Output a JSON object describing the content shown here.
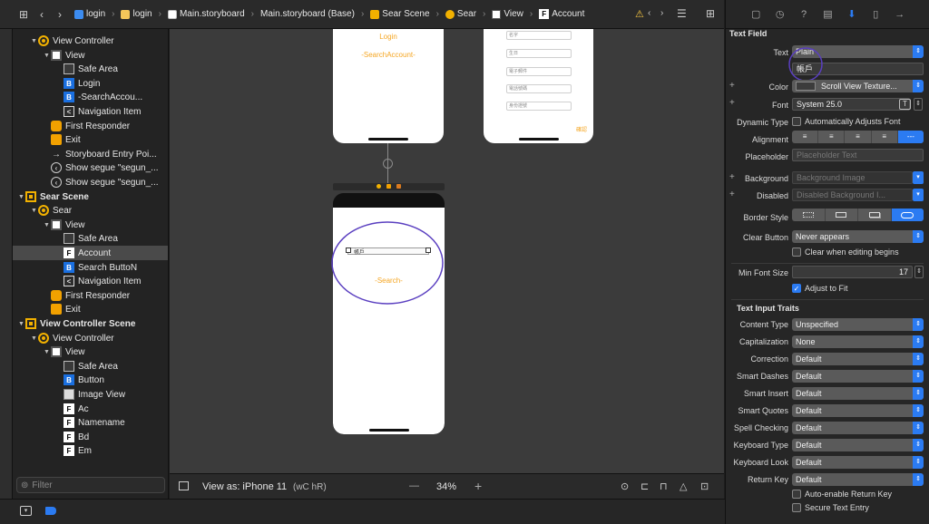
{
  "breadcrumb": [
    "login",
    "login",
    "Main.storyboard",
    "Main.storyboard (Base)",
    "Sear Scene",
    "Sear",
    "View",
    "Account"
  ],
  "navigator": {
    "rows": [
      {
        "label": "View Controller",
        "indent": 1,
        "tri": "▼",
        "icon": "vc"
      },
      {
        "label": "View",
        "indent": 2,
        "tri": "▼",
        "icon": "view"
      },
      {
        "label": "Safe Area",
        "indent": 3,
        "tri": "",
        "icon": "safe"
      },
      {
        "label": "Login",
        "indent": 3,
        "tri": "",
        "icon": "btn",
        "glyph": "B"
      },
      {
        "label": "-SearchAccou...",
        "indent": 3,
        "tri": "",
        "icon": "btn",
        "glyph": "B"
      },
      {
        "label": "Navigation Item",
        "indent": 3,
        "tri": "",
        "icon": "nav",
        "glyph": "<"
      },
      {
        "label": "First Responder",
        "indent": 2,
        "tri": "",
        "icon": "fr"
      },
      {
        "label": "Exit",
        "indent": 2,
        "tri": "",
        "icon": "exit"
      },
      {
        "label": "Storyboard Entry Poi...",
        "indent": 2,
        "tri": "",
        "icon": "arrow",
        "glyph": "→"
      },
      {
        "label": "Show segue \"segun_...",
        "indent": 2,
        "tri": "",
        "icon": "segue",
        "glyph": "‹"
      },
      {
        "label": "Show segue \"segun_...",
        "indent": 2,
        "tri": "",
        "icon": "segue",
        "glyph": "‹"
      },
      {
        "label": "Sear Scene",
        "indent": 0,
        "tri": "▼",
        "icon": "scn",
        "scene": true
      },
      {
        "label": "Sear",
        "indent": 1,
        "tri": "▼",
        "icon": "vc"
      },
      {
        "label": "View",
        "indent": 2,
        "tri": "▼",
        "icon": "view"
      },
      {
        "label": "Safe Area",
        "indent": 3,
        "tri": "",
        "icon": "safe"
      },
      {
        "label": "Account",
        "indent": 3,
        "tri": "",
        "icon": "f",
        "glyph": "F",
        "selected": true
      },
      {
        "label": "Search ButtoN",
        "indent": 3,
        "tri": "",
        "icon": "btn",
        "glyph": "B"
      },
      {
        "label": "Navigation Item",
        "indent": 3,
        "tri": "",
        "icon": "nav",
        "glyph": "<"
      },
      {
        "label": "First Responder",
        "indent": 2,
        "tri": "",
        "icon": "fr"
      },
      {
        "label": "Exit",
        "indent": 2,
        "tri": "",
        "icon": "exit"
      },
      {
        "label": "View Controller Scene",
        "indent": 0,
        "tri": "▼",
        "icon": "scn",
        "scene": true
      },
      {
        "label": "View Controller",
        "indent": 1,
        "tri": "▼",
        "icon": "vc"
      },
      {
        "label": "View",
        "indent": 2,
        "tri": "▼",
        "icon": "view"
      },
      {
        "label": "Safe Area",
        "indent": 3,
        "tri": "",
        "icon": "safe"
      },
      {
        "label": "Button",
        "indent": 3,
        "tri": "",
        "icon": "btn",
        "glyph": "B"
      },
      {
        "label": "Image View",
        "indent": 3,
        "tri": "",
        "icon": "img"
      },
      {
        "label": "Ac",
        "indent": 3,
        "tri": "",
        "icon": "f",
        "glyph": "F"
      },
      {
        "label": "Namename",
        "indent": 3,
        "tri": "",
        "icon": "f",
        "glyph": "F"
      },
      {
        "label": "Bd",
        "indent": 3,
        "tri": "",
        "icon": "f",
        "glyph": "F"
      },
      {
        "label": "Em",
        "indent": 3,
        "tri": "",
        "icon": "f",
        "glyph": "F"
      }
    ],
    "filter_placeholder": "Filter"
  },
  "canvas": {
    "login_label": "Login",
    "search_account_label": "-SearchAccount-",
    "register_fields": [
      "名字",
      "生日",
      "電子郵件",
      "電話號碼",
      "身份證號"
    ],
    "register_button": "確認",
    "account_placeholder": "帳戶",
    "search_label": "-Search-",
    "view_as": "View as: iPhone 11",
    "size_class": "(wC hR)",
    "zoom": "34%",
    "zoom_minus": "—",
    "zoom_plus": "+"
  },
  "inspector": {
    "section_title": "Text Field",
    "text_label": "Text",
    "text_type": "Plain",
    "text_value": "帳戶",
    "color_label": "Color",
    "color_value": "Scroll View Texture...",
    "font_label": "Font",
    "font_value": "System 25.0",
    "dynamic_type_label": "Dynamic Type",
    "dynamic_type_value": "Automatically Adjusts Font",
    "alignment_label": "Alignment",
    "placeholder_label": "Placeholder",
    "placeholder_hint": "Placeholder Text",
    "background_label": "Background",
    "background_hint": "Background Image",
    "disabled_label": "Disabled",
    "disabled_hint": "Disabled Background I...",
    "border_style_label": "Border Style",
    "clear_button_label": "Clear Button",
    "clear_button_value": "Never appears",
    "clear_editing": "Clear when editing begins",
    "min_font_label": "Min Font Size",
    "min_font_value": "17",
    "adjust_to_fit": "Adjust to Fit",
    "traits_title": "Text Input Traits",
    "traits": [
      {
        "label": "Content Type",
        "value": "Unspecified"
      },
      {
        "label": "Capitalization",
        "value": "None"
      },
      {
        "label": "Correction",
        "value": "Default"
      },
      {
        "label": "Smart Dashes",
        "value": "Default"
      },
      {
        "label": "Smart Insert",
        "value": "Default"
      },
      {
        "label": "Smart Quotes",
        "value": "Default"
      },
      {
        "label": "Spell Checking",
        "value": "Default"
      },
      {
        "label": "Keyboard Type",
        "value": "Default"
      },
      {
        "label": "Keyboard Look",
        "value": "Default"
      },
      {
        "label": "Return Key",
        "value": "Default"
      }
    ],
    "auto_return": "Auto-enable Return Key",
    "secure_entry": "Secure Text Entry"
  },
  "colors": {
    "accent": "#2b7bf2",
    "orange": "#f5a623",
    "annotation": "#5a3fc0"
  }
}
